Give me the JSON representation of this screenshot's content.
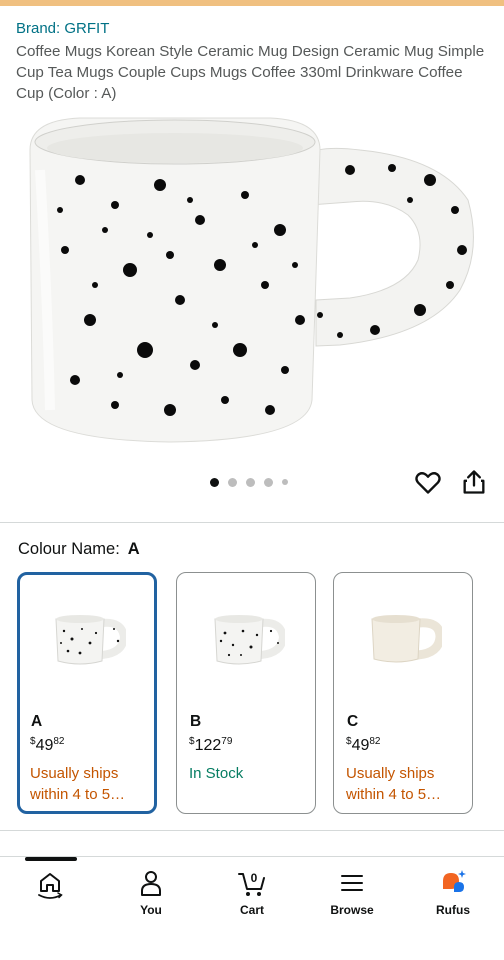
{
  "product": {
    "brand": "Brand: GRFIT",
    "title": "Coffee Mugs Korean Style Ceramic Mug Design Ceramic Mug Simple Cup Tea Mugs Couple Cups Mugs Coffee 330ml Drinkware Coffee Cup (Color : A)",
    "image_count": 5,
    "active_image": 1
  },
  "variations": {
    "label": "Colour Name:",
    "selected_value": "A",
    "options": [
      {
        "name": "A",
        "currency": "$",
        "price_whole": "49",
        "price_fraction": "82",
        "availability": "Usually ships within 4 to 5…",
        "status_color": "#c45500",
        "selected": true
      },
      {
        "name": "B",
        "currency": "$",
        "price_whole": "122",
        "price_fraction": "79",
        "availability": "In Stock",
        "status_color": "#067d62",
        "selected": false
      },
      {
        "name": "C",
        "currency": "$",
        "price_whole": "49",
        "price_fraction": "82",
        "availability": "Usually ships within 4 to 5…",
        "status_color": "#c45500",
        "selected": false
      }
    ]
  },
  "nav": {
    "items": [
      {
        "label": "",
        "icon": "home-icon"
      },
      {
        "label": "You",
        "icon": "person-icon"
      },
      {
        "label": "Cart",
        "icon": "cart-icon",
        "count": "0"
      },
      {
        "label": "Browse",
        "icon": "menu-icon"
      },
      {
        "label": "Rufus",
        "icon": "rufus-icon"
      }
    ]
  },
  "colors": {
    "link": "#007185",
    "selected_border": "#2162a1",
    "rufus_orange": "#f26522",
    "rufus_blue": "#1a73e8"
  }
}
